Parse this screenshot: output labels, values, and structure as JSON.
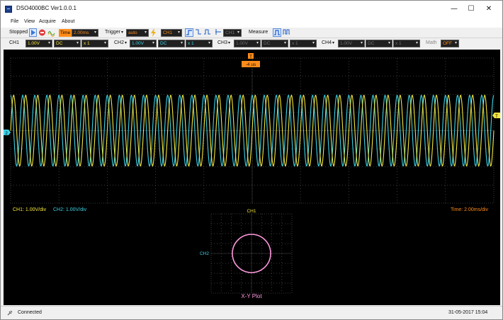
{
  "window": {
    "title": "DSO4000BC Ver1.0.0.1",
    "controls": {
      "minimize": "—",
      "maximize": "☐",
      "close": "✕"
    }
  },
  "menu": {
    "items": [
      "File",
      "View",
      "Acquire",
      "About"
    ]
  },
  "toolbar": {
    "state": "Stopped",
    "time_label": "Time",
    "time_value": "2.00ms",
    "trigger_label": "Trigger",
    "trigger_mode": "auto",
    "trigger_source": "CH1",
    "trigger_level_source": "CH1",
    "measure_label": "Measure"
  },
  "channels": [
    {
      "label": "CH1",
      "volts": "1.00V",
      "coupling": "DC",
      "probe": "x 1",
      "enabled": true,
      "color": "#f5e63c"
    },
    {
      "label": "CH2",
      "volts": "1.00V",
      "coupling": "DC",
      "probe": "x 1",
      "enabled": true,
      "color": "#3cd2e6"
    },
    {
      "label": "CH3",
      "volts": "1.00V",
      "coupling": "DC",
      "probe": "x 1",
      "enabled": false,
      "color": "#808080"
    },
    {
      "label": "CH4",
      "volts": "1.00V",
      "coupling": "DC",
      "probe": "x 1",
      "enabled": false,
      "color": "#808080"
    }
  ],
  "math": {
    "label": "Math",
    "value": "OFF"
  },
  "scope": {
    "trigger_offset_label": "-4 us",
    "ch1_scale_text": "CH1: 1.00V/div",
    "ch2_scale_text": "CH2: 1.00V/div",
    "time_scale_text": "Time: 2.00ms/div",
    "ch2_marker": "2",
    "trigger_marker": "T",
    "trigger_top_marker": "T",
    "waveform_cycles": 40,
    "colors": {
      "ch1": "#f5e63c",
      "ch2": "#3cd2e6",
      "grid": "#4a4a4a",
      "xy": "#ff99dd",
      "scale_text_time": "#ff8c1a"
    }
  },
  "xy_plot": {
    "title": "X-Y Plot",
    "x_label": "CH1",
    "y_label": "CH2"
  },
  "status": {
    "connection": "Connected",
    "datetime": "31-05-2017  15:04"
  }
}
